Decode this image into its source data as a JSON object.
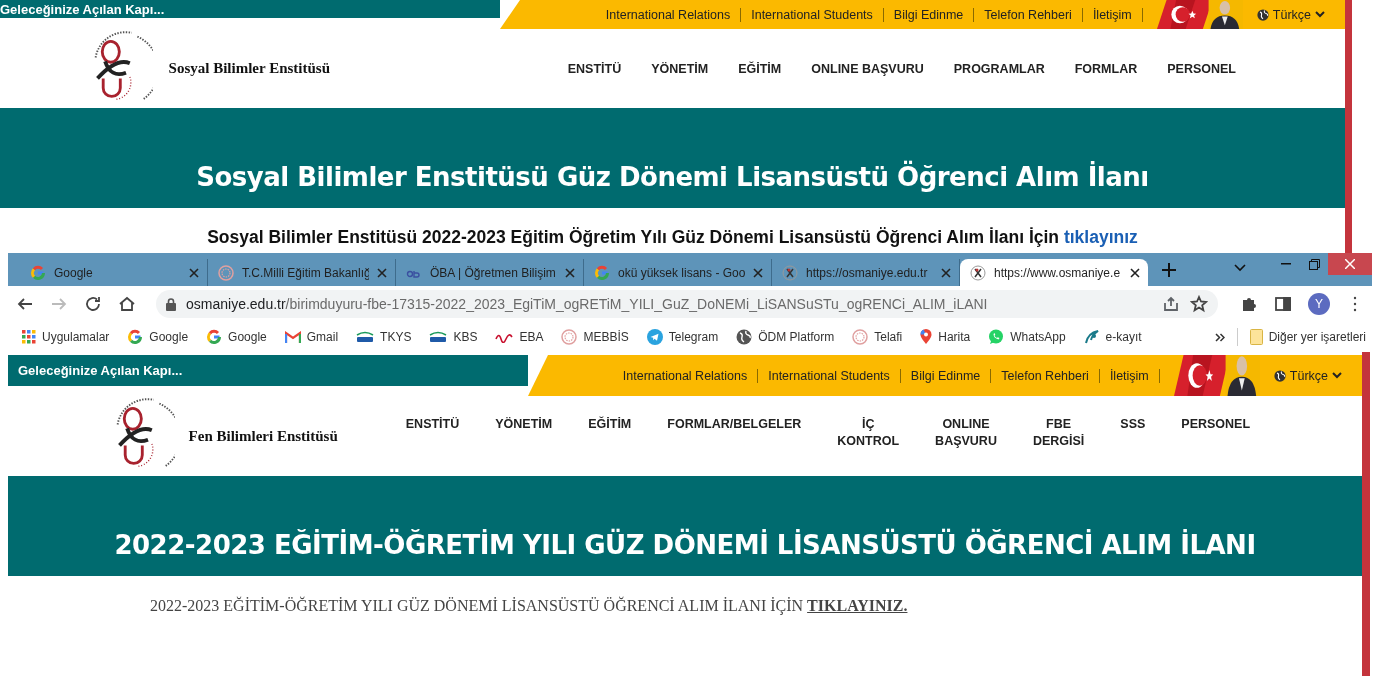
{
  "background_page": {
    "top_bar": {
      "slogan": "Geleceğinize Açılan Kapı...",
      "links": [
        "International Relations",
        "International Students",
        "Bilgi Edinme",
        "Telefon Rehberi",
        "İletişim"
      ],
      "language": "Türkçe"
    },
    "header": {
      "institute": "Sosyal Bilimler Enstitüsü",
      "nav": [
        "ENSTİTÜ",
        "YÖNETİM",
        "EĞİTİM",
        "ONLINE BAŞVURU",
        "PROGRAMLAR",
        "FORMLAR",
        "PERSONEL"
      ]
    },
    "banner": {
      "title": "Sosyal Bilimler Enstitüsü Güz Dönemi Lisansüstü Öğrenci Alım İlanı"
    },
    "announcement": {
      "text": "Sosyal Bilimler Enstitüsü 2022-2023 Eğitim Öğretim Yılı Güz Dönemi Lisansüstü Öğrenci Alım İlanı İçin",
      "link": "tıklayınız"
    }
  },
  "browser": {
    "tabs": [
      {
        "title": "Google",
        "selected": false
      },
      {
        "title": "T.C.Milli Eğitim Bakanlığ",
        "selected": false
      },
      {
        "title": "ÖBA | Öğretmen Bilişim",
        "selected": false
      },
      {
        "title": "okü yüksek lisans - Goo",
        "selected": false
      },
      {
        "title": "https://osmaniye.edu.tr",
        "selected": false
      },
      {
        "title": "https://www.osmaniye.e",
        "selected": true
      }
    ],
    "forward": {
      "disabled": true
    },
    "address": {
      "host": "osmaniye.edu.tr",
      "path": "/birimduyuru-fbe-17315-2022_2023_EgiTiM_ogRETiM_YILI_GuZ_DoNEMi_LiSANSuSTu_ogRENCi_ALIM_iLANI"
    },
    "avatar": "Y",
    "bookmarks": [
      "Uygulamalar",
      "Google",
      "Google",
      "Gmail",
      "TKYS",
      "KBS",
      "EBA",
      "MEBBİS",
      "Telegram",
      "ÖDM Platform",
      "Telafi",
      "Harita",
      "WhatsApp",
      "e-kayıt"
    ],
    "other_bookmarks": "Diğer yer işaretleri",
    "page": {
      "top_bar": {
        "slogan": "Geleceğinize Açılan Kapı...",
        "links": [
          "International Relations",
          "International Students",
          "Bilgi Edinme",
          "Telefon Rehberi",
          "İletişim"
        ],
        "language": "Türkçe"
      },
      "header": {
        "institute": "Fen Bilimleri Enstitüsü",
        "nav": [
          "ENSTİTÜ",
          "YÖNETİM",
          "EĞİTİM",
          "FORMLAR/BELGELER",
          "İÇ KONTROL",
          "ONLINE BAŞVURU",
          "FBE DERGİSİ",
          "SSS",
          "PERSONEL"
        ]
      },
      "banner": {
        "title": "2022-2023 EĞİTİM-ÖĞRETİM YILI GÜZ DÖNEMİ LİSANSÜSTÜ ÖĞRENCİ ALIM İLANI"
      },
      "announcement": {
        "text": "2022-2023 EĞİTİM-ÖĞRETİM YILI GÜZ DÖNEMİ LİSANSÜSTÜ ÖĞRENCİ ALIM İLANI İÇİN",
        "link": "TIKLAYINIZ."
      }
    }
  }
}
